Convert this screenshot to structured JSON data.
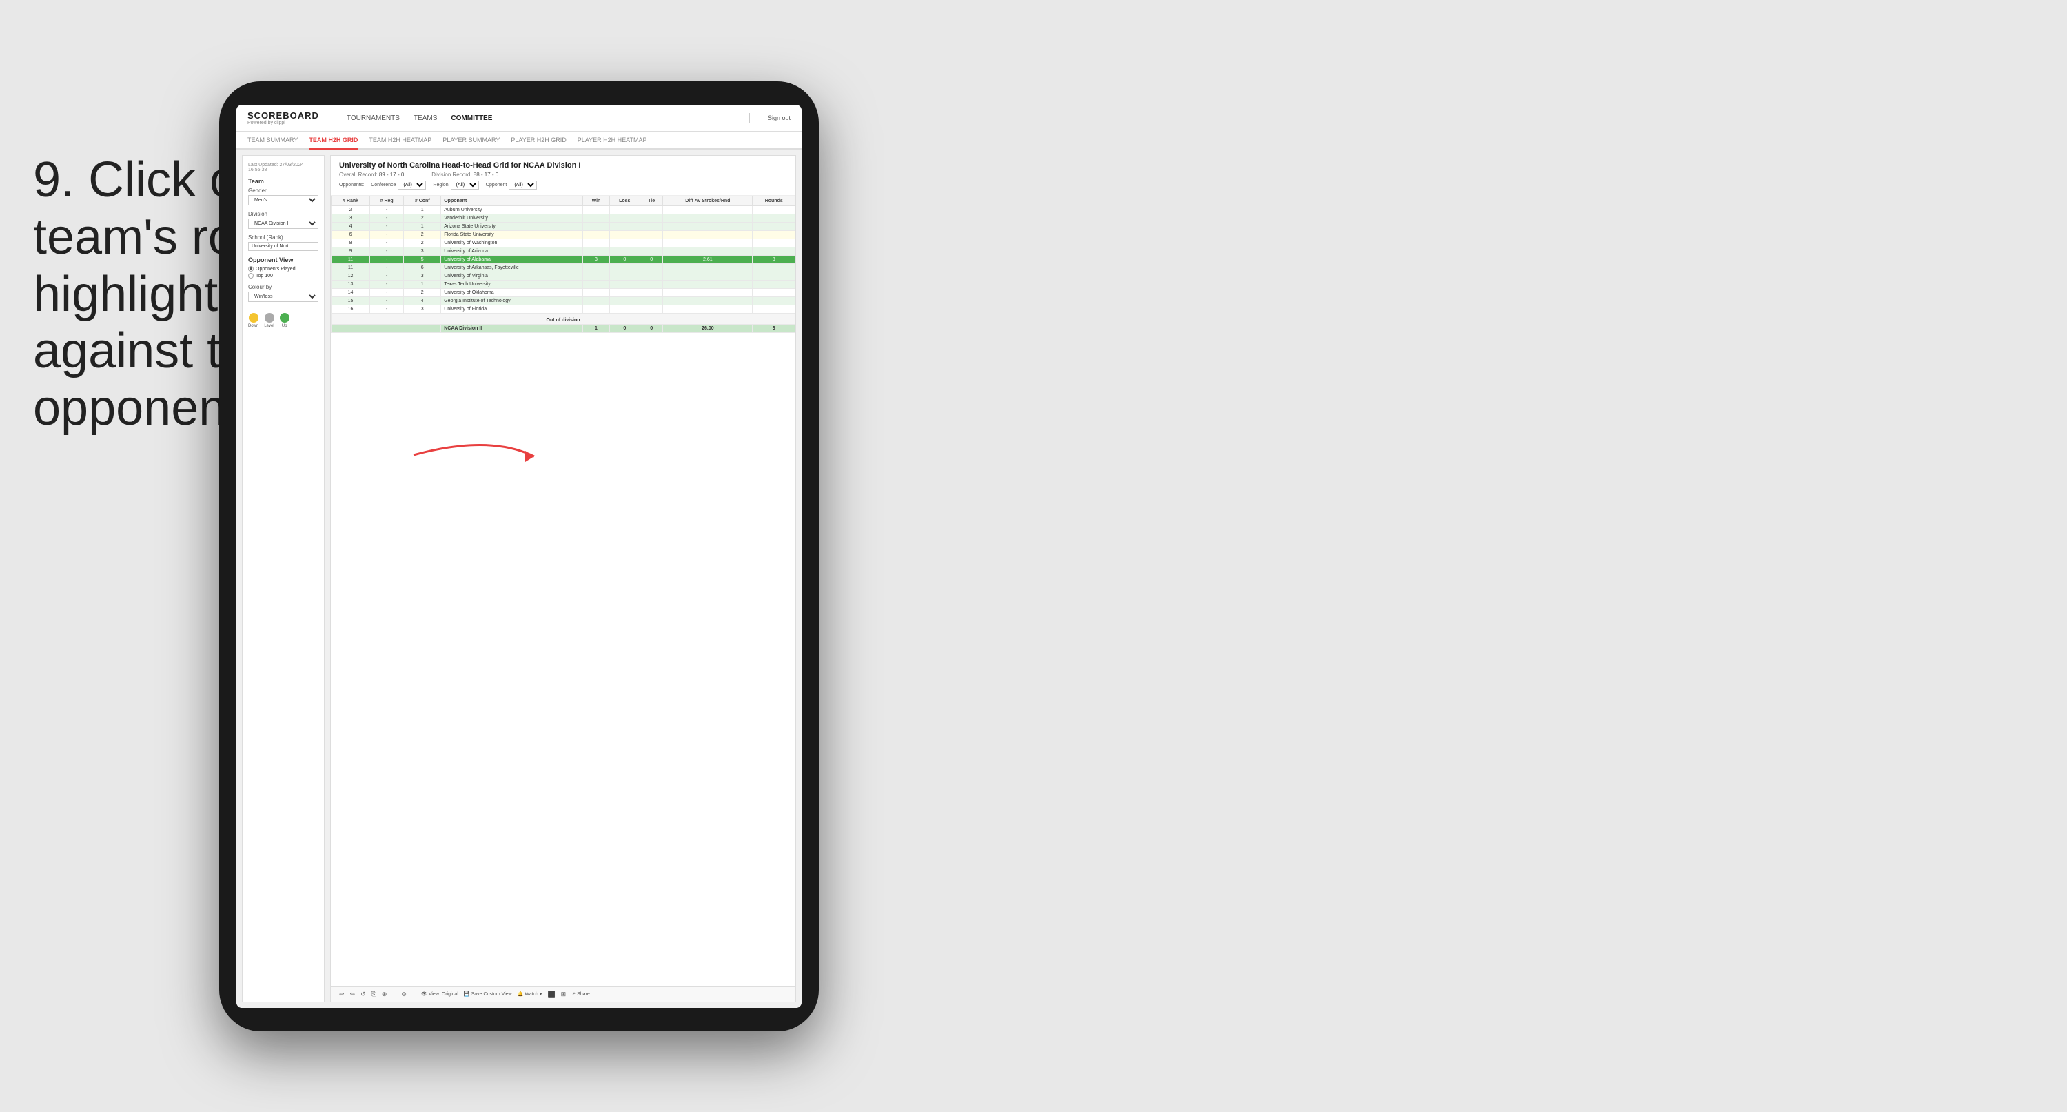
{
  "instruction": {
    "step": "9.",
    "text": "Click on a team's row to highlight results against that opponent"
  },
  "nav": {
    "logo": "SCOREBOARD",
    "logo_sub": "Powered by clippi",
    "items": [
      "TOURNAMENTS",
      "TEAMS",
      "COMMITTEE"
    ],
    "sign_out": "Sign out"
  },
  "sub_nav": {
    "items": [
      "TEAM SUMMARY",
      "TEAM H2H GRID",
      "TEAM H2H HEATMAP",
      "PLAYER SUMMARY",
      "PLAYER H2H GRID",
      "PLAYER H2H HEATMAP"
    ],
    "active": "TEAM H2H GRID"
  },
  "left_panel": {
    "last_updated": "Last Updated: 27/03/2024",
    "last_updated_time": "16:55:38",
    "team_label": "Team",
    "gender_label": "Gender",
    "gender_value": "Men's",
    "division_label": "Division",
    "division_value": "NCAA Division I",
    "school_label": "School (Rank)",
    "school_value": "University of Nort...",
    "opponent_view_label": "Opponent View",
    "radio_options": [
      "Opponents Played",
      "Top 100"
    ],
    "radio_selected": "Opponents Played",
    "colour_by_label": "Colour by",
    "colour_by_value": "Win/loss",
    "legend": [
      {
        "color": "#f4c430",
        "label": "Down"
      },
      {
        "color": "#aaaaaa",
        "label": "Level"
      },
      {
        "color": "#4caf50",
        "label": "Up"
      }
    ]
  },
  "grid": {
    "title": "University of North Carolina Head-to-Head Grid for NCAA Division I",
    "overall_record_label": "Overall Record:",
    "overall_record": "89 - 17 - 0",
    "division_record_label": "Division Record:",
    "division_record": "88 - 17 - 0",
    "filters": {
      "opponents_label": "Opponents:",
      "conference_label": "Conference",
      "conference_value": "(All)",
      "region_label": "Region",
      "region_value": "(All)",
      "opponent_label": "Opponent",
      "opponent_value": "(All)"
    },
    "columns": [
      "# Rank",
      "# Reg",
      "# Conf",
      "Opponent",
      "Win",
      "Loss",
      "Tie",
      "Diff Av Strokes/Rnd",
      "Rounds"
    ],
    "rows": [
      {
        "rank": "2",
        "reg": "-",
        "conf": "1",
        "opponent": "Auburn University",
        "win": "",
        "loss": "",
        "tie": "",
        "diff": "",
        "rounds": "",
        "highlight": false,
        "color": "none"
      },
      {
        "rank": "3",
        "reg": "-",
        "conf": "2",
        "opponent": "Vanderbilt University",
        "win": "",
        "loss": "",
        "tie": "",
        "diff": "",
        "rounds": "",
        "highlight": false,
        "color": "light-green"
      },
      {
        "rank": "4",
        "reg": "-",
        "conf": "1",
        "opponent": "Arizona State University",
        "win": "",
        "loss": "",
        "tie": "",
        "diff": "",
        "rounds": "",
        "highlight": false,
        "color": "light-green"
      },
      {
        "rank": "6",
        "reg": "-",
        "conf": "2",
        "opponent": "Florida State University",
        "win": "",
        "loss": "",
        "tie": "",
        "diff": "",
        "rounds": "",
        "highlight": false,
        "color": "light-yellow"
      },
      {
        "rank": "8",
        "reg": "-",
        "conf": "2",
        "opponent": "University of Washington",
        "win": "",
        "loss": "",
        "tie": "",
        "diff": "",
        "rounds": "",
        "highlight": false,
        "color": "none"
      },
      {
        "rank": "9",
        "reg": "-",
        "conf": "3",
        "opponent": "University of Arizona",
        "win": "",
        "loss": "",
        "tie": "",
        "diff": "",
        "rounds": "",
        "highlight": false,
        "color": "light-green"
      },
      {
        "rank": "11",
        "reg": "-",
        "conf": "5",
        "opponent": "University of Alabama",
        "win": "3",
        "loss": "0",
        "tie": "0",
        "diff": "2.61",
        "rounds": "8",
        "highlight": true,
        "color": "green"
      },
      {
        "rank": "11",
        "reg": "-",
        "conf": "6",
        "opponent": "University of Arkansas, Fayetteville",
        "win": "",
        "loss": "",
        "tie": "",
        "diff": "",
        "rounds": "",
        "highlight": false,
        "color": "light-green"
      },
      {
        "rank": "12",
        "reg": "-",
        "conf": "3",
        "opponent": "University of Virginia",
        "win": "",
        "loss": "",
        "tie": "",
        "diff": "",
        "rounds": "",
        "highlight": false,
        "color": "light-green"
      },
      {
        "rank": "13",
        "reg": "-",
        "conf": "1",
        "opponent": "Texas Tech University",
        "win": "",
        "loss": "",
        "tie": "",
        "diff": "",
        "rounds": "",
        "highlight": false,
        "color": "light-green"
      },
      {
        "rank": "14",
        "reg": "-",
        "conf": "2",
        "opponent": "University of Oklahoma",
        "win": "",
        "loss": "",
        "tie": "",
        "diff": "",
        "rounds": "",
        "highlight": false,
        "color": "none"
      },
      {
        "rank": "15",
        "reg": "-",
        "conf": "4",
        "opponent": "Georgia Institute of Technology",
        "win": "",
        "loss": "",
        "tie": "",
        "diff": "",
        "rounds": "",
        "highlight": false,
        "color": "light-green"
      },
      {
        "rank": "16",
        "reg": "-",
        "conf": "3",
        "opponent": "University of Florida",
        "win": "",
        "loss": "",
        "tie": "",
        "diff": "",
        "rounds": "",
        "highlight": false,
        "color": "none"
      }
    ],
    "out_of_division_label": "Out of division",
    "out_of_division_rows": [
      {
        "label": "NCAA Division II",
        "win": "1",
        "loss": "0",
        "tie": "0",
        "diff": "26.00",
        "rounds": "3"
      }
    ]
  },
  "toolbar": {
    "view_label": "View: Original",
    "save_label": "Save Custom View",
    "watch_label": "Watch",
    "share_label": "Share"
  }
}
